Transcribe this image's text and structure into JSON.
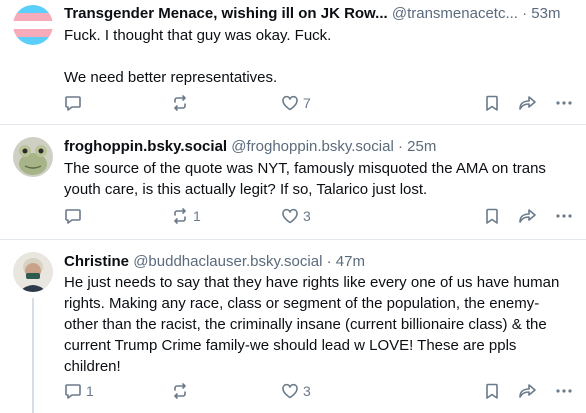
{
  "posts": [
    {
      "author": "Transgender Menace, wishing ill on JK Row...",
      "handle": "@transmenacetc...",
      "separator": "·",
      "time": "53m",
      "text": "Fuck. I thought that guy was okay. Fuck.\n\nWe need better representatives.",
      "replies": "",
      "reposts": "",
      "likes": "7"
    },
    {
      "author": "froghoppin.bsky.social",
      "handle": "@froghoppin.bsky.social",
      "separator": "·",
      "time": "25m",
      "text": "The source of the quote was NYT, famously misquoted the AMA on trans youth care, is this actually legit? If so, Talarico just lost.",
      "replies": "",
      "reposts": "1",
      "likes": "3"
    },
    {
      "author": "Christine",
      "handle": "@buddhaclauser.bsky.social",
      "separator": "·",
      "time": "47m",
      "text": "He just needs to say that they have rights like every one of us have human rights. Making any race, class or segment of the population, the enemy-other than the racist, the criminally insane (current billionaire class) & the current Trump Crime family-we should lead w LOVE! These are ppls children!",
      "replies": "1",
      "reposts": "",
      "likes": "3"
    }
  ],
  "icons": {
    "reply": "reply-icon",
    "repost": "repost-icon",
    "like": "like-icon",
    "bookmark": "bookmark-icon",
    "share": "share-icon",
    "more": "more-options-icon"
  },
  "colors": {
    "text": "#0b0f14",
    "muted": "#5b6b7c",
    "icon": "#6b7a8a",
    "divider": "#e3e8ee",
    "flag_blue": "#5bcffa",
    "flag_pink": "#f5abb9"
  }
}
